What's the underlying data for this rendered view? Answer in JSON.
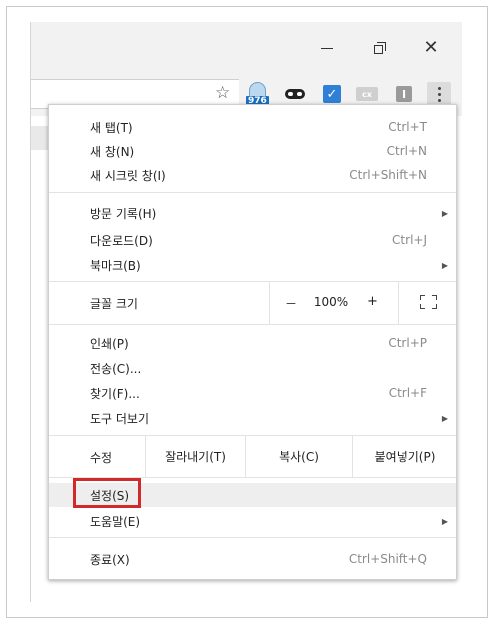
{
  "window": {
    "minimize_label": "—",
    "close_label": "✕"
  },
  "toolbar": {
    "bookmark_star": "☆",
    "extensions": [
      {
        "icon": "badge-counter-icon",
        "badge": "976"
      },
      {
        "icon": "incognito-mask-icon"
      },
      {
        "icon": "checkmark-extension-icon",
        "glyph": "✓"
      },
      {
        "icon": "cx-extension-icon",
        "glyph": "cx"
      },
      {
        "icon": "gray-square-extension-icon",
        "glyph": "I"
      }
    ],
    "menu_button_icon": "kebab-menu-icon"
  },
  "menu": {
    "new_tab": {
      "label": "새 탭(T)",
      "shortcut": "Ctrl+T"
    },
    "new_window": {
      "label": "새 창(N)",
      "shortcut": "Ctrl+N"
    },
    "new_incognito": {
      "label": "새 시크릿 창(I)",
      "shortcut": "Ctrl+Shift+N"
    },
    "history": {
      "label": "방문 기록(H)"
    },
    "downloads": {
      "label": "다운로드(D)",
      "shortcut": "Ctrl+J"
    },
    "bookmarks": {
      "label": "북마크(B)"
    },
    "zoom": {
      "label": "글꼴 크기",
      "minus": "－",
      "value": "100%",
      "plus": "+"
    },
    "print": {
      "label": "인쇄(P)",
      "shortcut": "Ctrl+P"
    },
    "cast": {
      "label": "전송(C)..."
    },
    "find": {
      "label": "찾기(F)...",
      "shortcut": "Ctrl+F"
    },
    "more_tools": {
      "label": "도구 더보기"
    },
    "edit": {
      "label": "수정",
      "cut": "잘라내기(T)",
      "copy": "복사(C)",
      "paste": "붙여넣기(P)"
    },
    "settings": {
      "label": "설정(S)"
    },
    "help": {
      "label": "도움말(E)"
    },
    "exit": {
      "label": "종료(X)",
      "shortcut": "Ctrl+Shift+Q"
    }
  },
  "colors": {
    "highlight_box": "#d22a2a",
    "badge_blue": "#1b6fbf",
    "check_blue": "#2f7fd6"
  }
}
